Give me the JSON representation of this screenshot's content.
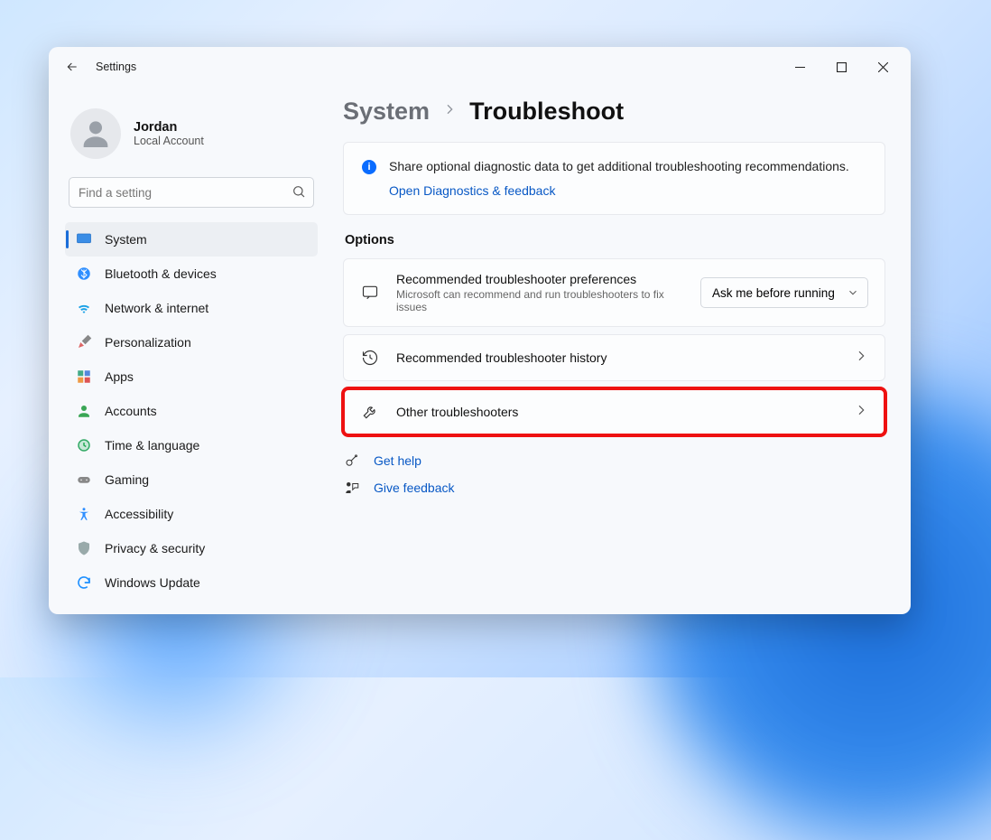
{
  "app": {
    "title": "Settings"
  },
  "user": {
    "name": "Jordan",
    "sub": "Local Account"
  },
  "search": {
    "placeholder": "Find a setting"
  },
  "nav": [
    {
      "key": "system",
      "label": "System",
      "selected": true
    },
    {
      "key": "bluetooth",
      "label": "Bluetooth & devices"
    },
    {
      "key": "network",
      "label": "Network & internet"
    },
    {
      "key": "personalization",
      "label": "Personalization"
    },
    {
      "key": "apps",
      "label": "Apps"
    },
    {
      "key": "accounts",
      "label": "Accounts"
    },
    {
      "key": "time",
      "label": "Time & language"
    },
    {
      "key": "gaming",
      "label": "Gaming"
    },
    {
      "key": "accessibility",
      "label": "Accessibility"
    },
    {
      "key": "privacy",
      "label": "Privacy & security"
    },
    {
      "key": "update",
      "label": "Windows Update"
    }
  ],
  "breadcrumb": {
    "parent": "System",
    "current": "Troubleshoot"
  },
  "info": {
    "text": "Share optional diagnostic data to get additional troubleshooting recommendations.",
    "link": "Open Diagnostics & feedback"
  },
  "options_heading": "Options",
  "opt_pref": {
    "title": "Recommended troubleshooter preferences",
    "sub": "Microsoft can recommend and run troubleshooters to fix issues",
    "dropdown": "Ask me before running"
  },
  "opt_history": {
    "title": "Recommended troubleshooter history"
  },
  "opt_other": {
    "title": "Other troubleshooters"
  },
  "footer": {
    "help": "Get help",
    "feedback": "Give feedback"
  }
}
